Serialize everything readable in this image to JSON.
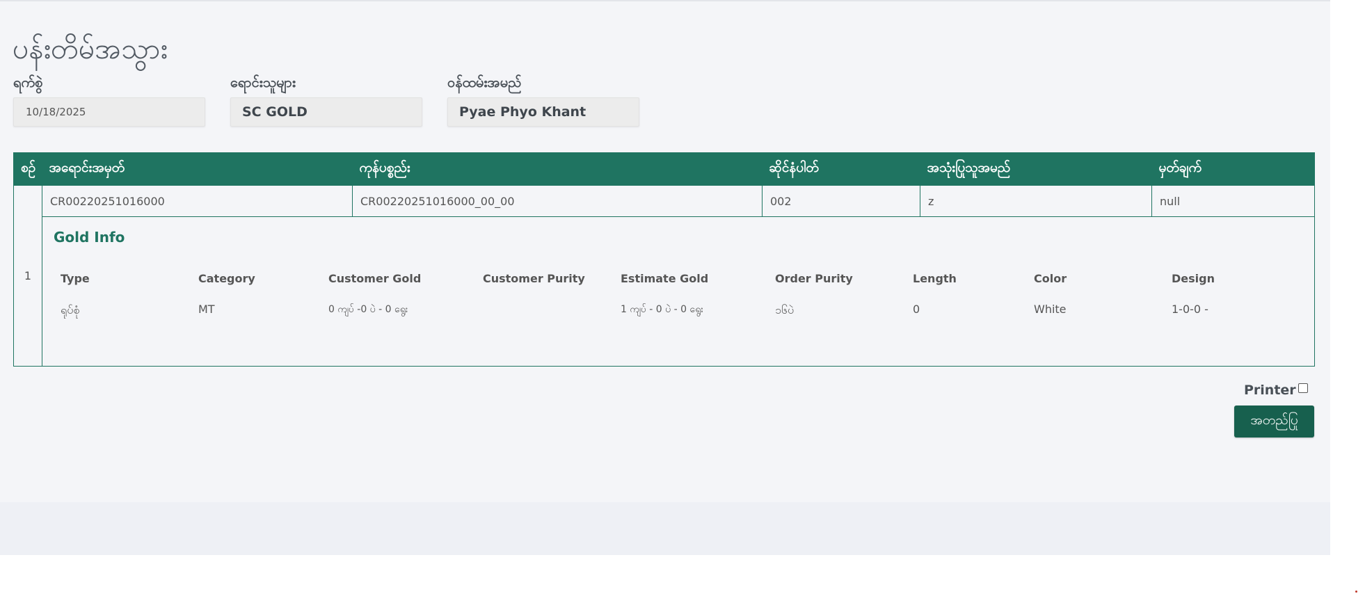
{
  "page": {
    "title": "ပန်းတိမ်အသွား"
  },
  "fields": {
    "date": {
      "label": "ရက်စွဲ",
      "value": "10/18/2025"
    },
    "vendor": {
      "label": "ရောင်းသူများ",
      "value": "SC GOLD"
    },
    "staff": {
      "label": "ဝန်ထမ်းအမည်",
      "value": "Pyae Phyo Khant"
    }
  },
  "table": {
    "headers": [
      "စဉ်",
      "အရောင်းအမှတ်",
      "ကုန်ပစ္စည်း",
      "ဆိုင်နံပါတ်",
      "အသုံးပြုသူအမည်",
      "မှတ်ချက်"
    ],
    "rows": [
      {
        "index": "1",
        "sale_no": "CR00220251016000",
        "product": "CR00220251016000_00_00",
        "shop_no": "002",
        "user_name": "z",
        "remark": "null",
        "gold_info": {
          "title": "Gold Info",
          "headers": [
            "Type",
            "Category",
            "Customer Gold",
            "Customer Purity",
            "Estimate Gold",
            "Order Purity",
            "Length",
            "Color",
            "Design"
          ],
          "values": [
            "ရုပ်စုံ",
            "MT",
            "0 ကျပ် -0 ပဲ - 0 ရွေး",
            "",
            "1 ကျပ် - 0 ပဲ - 0 ရွေး",
            "၁၆ပဲ",
            "0",
            "White",
            "1-0-0 -"
          ]
        }
      }
    ]
  },
  "footer": {
    "printer_label": "Printer",
    "printer_checked": false,
    "save_label": "အတည်ပြု"
  },
  "colors": {
    "accent": "#1f7461",
    "button": "#17604e",
    "background": "#f4f5f8"
  }
}
